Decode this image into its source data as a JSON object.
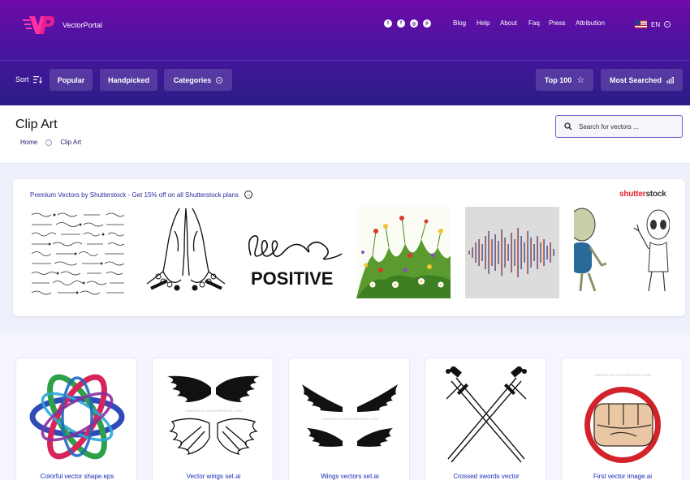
{
  "header": {
    "brand": "VectorPortal",
    "logo_text": "VP",
    "social": [
      "twitter-icon",
      "facebook-icon",
      "dribbble-icon",
      "pinterest-icon"
    ],
    "nav": [
      "Blog",
      "Help",
      "About",
      "Faq",
      "Press",
      "Attribution"
    ],
    "language": "EN"
  },
  "filters": {
    "sort_label": "Sort",
    "popular": "Popular",
    "handpicked": "Handpicked",
    "categories": "Categories",
    "top100": "Top 100",
    "most_searched": "Most Searched"
  },
  "page": {
    "title": "Clip Art",
    "breadcrumbs": [
      "Home",
      "Clip Art"
    ],
    "search_placeholder": "Search for vectors ..."
  },
  "promo": {
    "text": "Premium Vectors by Shutterstock - Get 15% off on all Shutterstock plans",
    "logo_red": "shutter",
    "logo_dark": "stock",
    "positive_text": "POSITIVE"
  },
  "cards": [
    {
      "caption": "Colorful vector shape.eps"
    },
    {
      "caption": "Vector wings set.ai"
    },
    {
      "caption": "Wings vectors set.ai"
    },
    {
      "caption": "Crossed swords vector"
    },
    {
      "caption": "First vector image.ai"
    }
  ],
  "watermark": "CREATED BY VECTORPORTAL.COM",
  "colors": {
    "header_top": "#6f0aa8",
    "header_bottom": "#2b1d86",
    "link_blue": "#1b2cb8",
    "shutterstock_red": "#e3262f"
  }
}
